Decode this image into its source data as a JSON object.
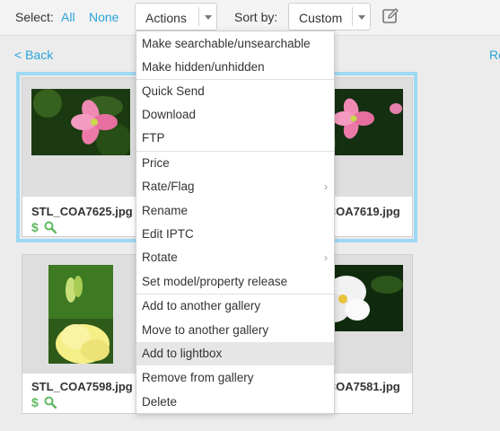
{
  "toolbar": {
    "select_label": "Select:",
    "select_all": "All",
    "select_none": "None",
    "actions_label": "Actions",
    "sort_label": "Sort by:",
    "sort_value": "Custom"
  },
  "nav": {
    "back": "< Back",
    "next": "Re"
  },
  "photos": [
    {
      "filename": "STL_COA7625.jpg",
      "selected": true
    },
    {
      "filename": "STL_COA7619.jpg",
      "selected": false
    },
    {
      "filename": "STL_COA7598.jpg",
      "selected": false
    },
    {
      "filename": "STL_COA7581.jpg",
      "selected": false
    }
  ],
  "actions_menu": {
    "items": [
      {
        "label": "Make searchable/unsearchable",
        "submenu": false
      },
      {
        "label": "Make hidden/unhidden",
        "submenu": false
      },
      {
        "label": "Quick Send",
        "submenu": false
      },
      {
        "label": "Download",
        "submenu": false
      },
      {
        "label": "FTP",
        "submenu": false
      },
      {
        "label": "Price",
        "submenu": false
      },
      {
        "label": "Rate/Flag",
        "submenu": true
      },
      {
        "label": "Rename",
        "submenu": false
      },
      {
        "label": "Edit IPTC",
        "submenu": false
      },
      {
        "label": "Rotate",
        "submenu": true
      },
      {
        "label": "Set model/property release",
        "submenu": false
      },
      {
        "label": "Add to another gallery",
        "submenu": false
      },
      {
        "label": "Move to another gallery",
        "submenu": false
      },
      {
        "label": "Add to lightbox",
        "submenu": false,
        "highlighted": true
      },
      {
        "label": "Remove from gallery",
        "submenu": false
      },
      {
        "label": "Delete",
        "submenu": false
      }
    ],
    "submenu_glyph": "›"
  },
  "colors": {
    "link": "#2aa3d9",
    "selection_outline": "#9dd9f3",
    "icon_green": "#5fb85f",
    "menu_hover": "#e6e6e6"
  },
  "icons": {
    "edit": "edit-pencil-icon",
    "price": "dollar-icon",
    "zoom": "magnifier-icon"
  }
}
